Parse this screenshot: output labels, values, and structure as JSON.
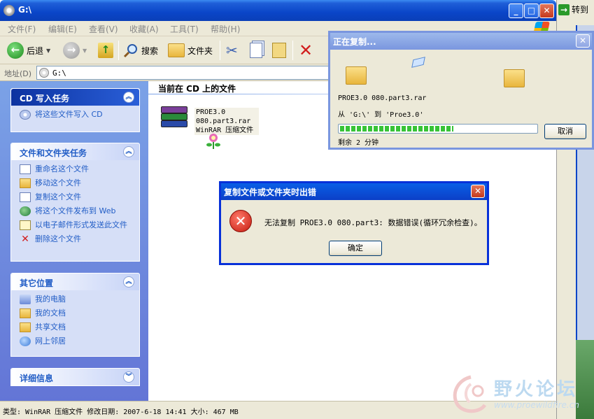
{
  "window": {
    "title": "G:\\",
    "min_label": "_",
    "max_label": "□",
    "close_label": "✕"
  },
  "goto_label": "转到",
  "menu": [
    "文件(F)",
    "编辑(E)",
    "查看(V)",
    "收藏(A)",
    "工具(T)",
    "帮助(H)"
  ],
  "toolbar": {
    "back_label": "后退",
    "search_label": "搜索",
    "folders_label": "文件夹"
  },
  "address": {
    "label": "地址(D)",
    "value": "G:\\"
  },
  "tasks": {
    "cd": {
      "title": "CD 写入任务",
      "items": [
        "将这些文件写入 CD"
      ]
    },
    "file": {
      "title": "文件和文件夹任务",
      "items": [
        "重命名这个文件",
        "移动这个文件",
        "复制这个文件",
        "将这个文件发布到 Web",
        "以电子邮件形式发送此文件",
        "删除这个文件"
      ]
    },
    "places": {
      "title": "其它位置",
      "items": [
        "我的电脑",
        "我的文档",
        "共享文档",
        "网上邻居"
      ]
    },
    "details": {
      "title": "详细信息"
    }
  },
  "content": {
    "header": "当前在 CD 上的文件",
    "file": {
      "line1": "PROE3.0",
      "line2": "080.part3.rar",
      "line3": "WinRAR 压缩文件"
    }
  },
  "status": "类型: WinRAR 压缩文件 修改日期: 2007-6-18 14:41 大小: 467 MB",
  "copy_dialog": {
    "title": "正在复制...",
    "filename": "PROE3.0 080.part3.rar",
    "fromto": "从 'G:\\' 到 'Proe3.0'",
    "progress": 0.58,
    "remaining": "剩余 2 分钟",
    "cancel_label": "取消"
  },
  "error_dialog": {
    "title": "复制文件或文件夹时出错",
    "message": "无法复制 PROE3.0 080.part3: 数据错误(循环冗余检查)。",
    "ok_label": "确定"
  },
  "watermark": {
    "text": "野火论坛",
    "url": "www.proewildfire.cn"
  },
  "colors": {
    "xp_title_blue": "#0a45c8",
    "task_link": "#215dc6",
    "progress_green": "#37c337",
    "error_red": "#c41a0e"
  }
}
